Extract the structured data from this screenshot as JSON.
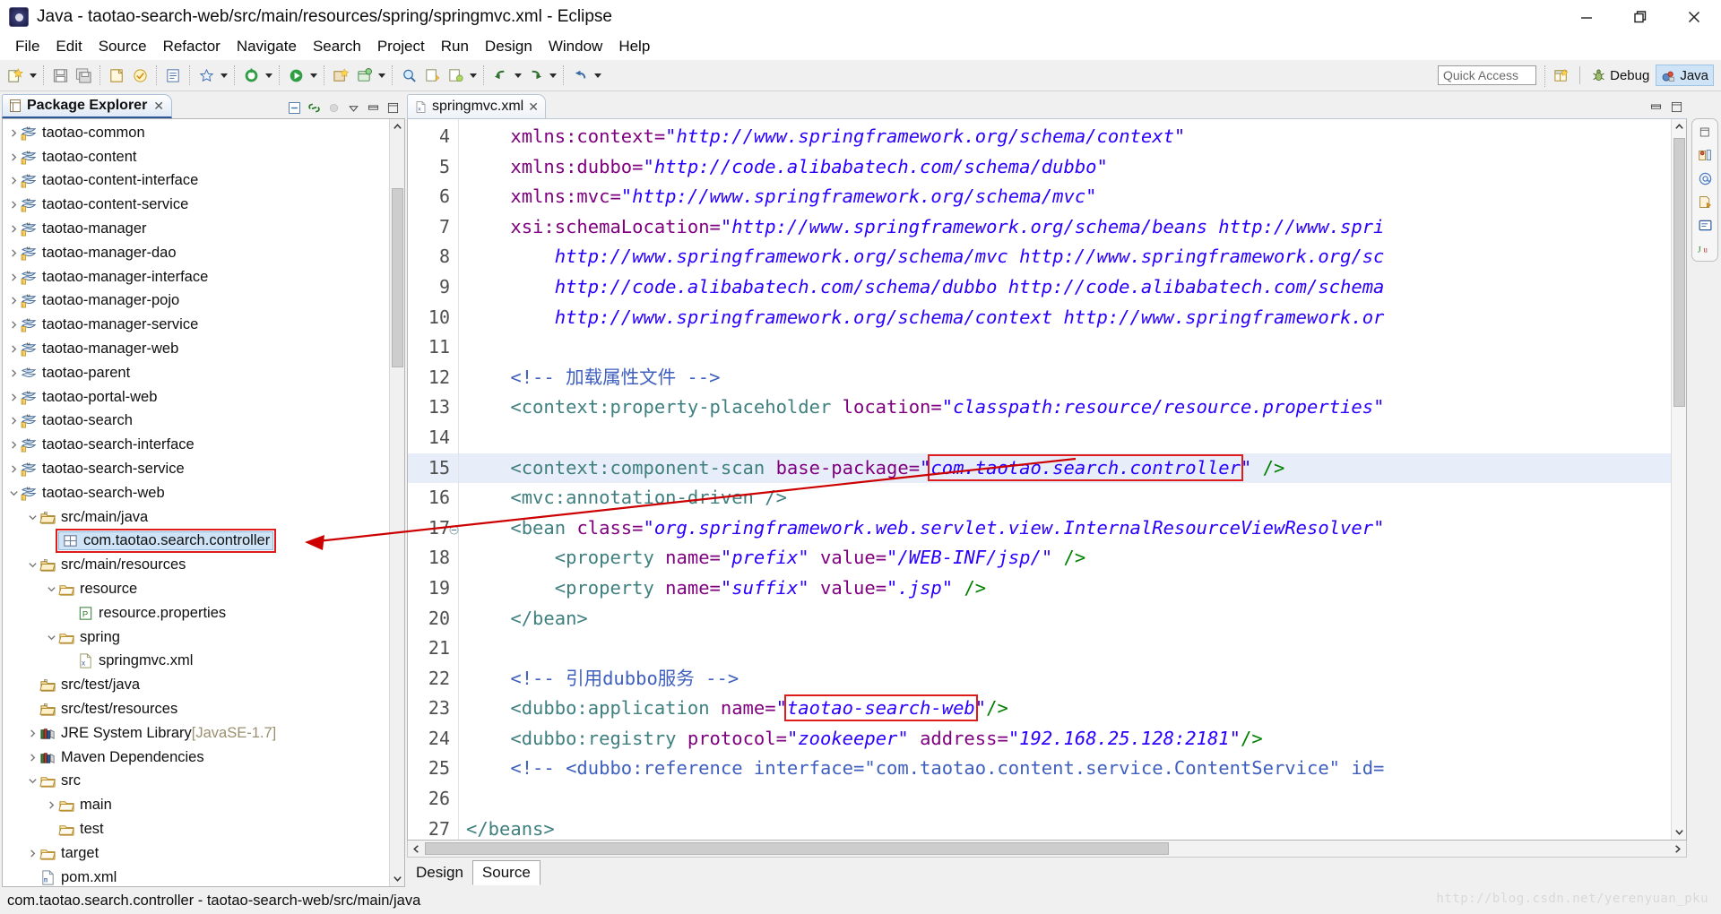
{
  "window": {
    "title": "Java - taotao-search-web/src/main/resources/spring/springmvc.xml - Eclipse",
    "app_icon": "eclipse-icon",
    "minimize_label": "Minimize",
    "restore_label": "Restore",
    "close_label": "Close"
  },
  "menubar": {
    "items": [
      "File",
      "Edit",
      "Source",
      "Refactor",
      "Navigate",
      "Search",
      "Project",
      "Run",
      "Design",
      "Window",
      "Help"
    ]
  },
  "toolbar": {
    "quick_access_placeholder": "Quick Access",
    "open_perspective_label": "Open Perspective",
    "perspectives": [
      {
        "label": "Debug",
        "icon": "debug-bug-icon",
        "active": false
      },
      {
        "label": "Java",
        "icon": "java-perspective-icon",
        "active": true
      }
    ],
    "buttons": [
      "new-wizard-icon",
      "new-wizard-dropdown",
      "save-icon",
      "save-all-icon",
      "print-icon",
      "build-icon",
      "new-java-class-icon",
      "external-tools-icon",
      "external-tools-dropdown",
      "debug-icon",
      "debug-dropdown",
      "run-icon",
      "run-dropdown",
      "new-java-project-icon",
      "new-package-icon",
      "new-package-dropdown",
      "search-icon",
      "next-annotation-icon",
      "previous-annotation-icon",
      "annotation-dropdown",
      "back-icon",
      "back-dropdown",
      "forward-icon",
      "undo-icon",
      "redo-icon",
      "pin-icon",
      "pin-dropdown"
    ]
  },
  "package_explorer": {
    "title": "Package Explorer",
    "close_label": "✕",
    "tools": [
      "collapse-all-icon",
      "link-with-editor-icon",
      "focus-on-active-task-icon",
      "view-menu-icon",
      "minimize-icon",
      "maximize-icon"
    ],
    "tree": [
      {
        "label": "taotao-common",
        "indent": 0,
        "twisty": "collapsed",
        "icon": "maven-project-icon"
      },
      {
        "label": "taotao-content",
        "indent": 0,
        "twisty": "collapsed",
        "icon": "maven-project-icon"
      },
      {
        "label": "taotao-content-interface",
        "indent": 0,
        "twisty": "collapsed",
        "icon": "maven-project-icon"
      },
      {
        "label": "taotao-content-service",
        "indent": 0,
        "twisty": "collapsed",
        "icon": "maven-project-icon"
      },
      {
        "label": "taotao-manager",
        "indent": 0,
        "twisty": "collapsed",
        "icon": "maven-project-icon"
      },
      {
        "label": "taotao-manager-dao",
        "indent": 0,
        "twisty": "collapsed",
        "icon": "maven-project-icon"
      },
      {
        "label": "taotao-manager-interface",
        "indent": 0,
        "twisty": "collapsed",
        "icon": "maven-project-icon"
      },
      {
        "label": "taotao-manager-pojo",
        "indent": 0,
        "twisty": "collapsed",
        "icon": "maven-project-icon"
      },
      {
        "label": "taotao-manager-service",
        "indent": 0,
        "twisty": "collapsed",
        "icon": "maven-project-icon"
      },
      {
        "label": "taotao-manager-web",
        "indent": 0,
        "twisty": "collapsed",
        "icon": "maven-project-icon"
      },
      {
        "label": "taotao-parent",
        "indent": 0,
        "twisty": "collapsed",
        "icon": "maven-pom-project-icon"
      },
      {
        "label": "taotao-portal-web",
        "indent": 0,
        "twisty": "collapsed",
        "icon": "maven-project-icon"
      },
      {
        "label": "taotao-search",
        "indent": 0,
        "twisty": "collapsed",
        "icon": "maven-project-icon"
      },
      {
        "label": "taotao-search-interface",
        "indent": 0,
        "twisty": "collapsed",
        "icon": "maven-project-icon"
      },
      {
        "label": "taotao-search-service",
        "indent": 0,
        "twisty": "collapsed",
        "icon": "maven-project-icon"
      },
      {
        "label": "taotao-search-web",
        "indent": 0,
        "twisty": "expanded",
        "icon": "maven-project-icon"
      },
      {
        "label": "src/main/java",
        "indent": 1,
        "twisty": "expanded",
        "icon": "source-folder-icon"
      },
      {
        "label": "com.taotao.search.controller",
        "indent": 2,
        "twisty": "none",
        "icon": "package-icon",
        "selected": true,
        "highlight": true
      },
      {
        "label": "src/main/resources",
        "indent": 1,
        "twisty": "expanded",
        "icon": "source-folder-icon"
      },
      {
        "label": "resource",
        "indent": 2,
        "twisty": "expanded",
        "icon": "folder-icon"
      },
      {
        "label": "resource.properties",
        "indent": 3,
        "twisty": "none",
        "icon": "properties-file-icon"
      },
      {
        "label": "spring",
        "indent": 2,
        "twisty": "expanded",
        "icon": "folder-icon"
      },
      {
        "label": "springmvc.xml",
        "indent": 3,
        "twisty": "none",
        "icon": "xml-file-icon"
      },
      {
        "label": "src/test/java",
        "indent": 1,
        "twisty": "none",
        "icon": "source-folder-icon"
      },
      {
        "label": "src/test/resources",
        "indent": 1,
        "twisty": "none",
        "icon": "source-folder-icon"
      },
      {
        "label": "JRE System Library",
        "suffix": " [JavaSE-1.7]",
        "indent": 1,
        "twisty": "collapsed",
        "icon": "library-icon"
      },
      {
        "label": "Maven Dependencies",
        "indent": 1,
        "twisty": "collapsed",
        "icon": "library-icon"
      },
      {
        "label": "src",
        "indent": 1,
        "twisty": "expanded",
        "icon": "folder-icon"
      },
      {
        "label": "main",
        "indent": 2,
        "twisty": "collapsed",
        "icon": "folder-icon"
      },
      {
        "label": "test",
        "indent": 2,
        "twisty": "none",
        "icon": "folder-icon"
      },
      {
        "label": "target",
        "indent": 1,
        "twisty": "collapsed",
        "icon": "folder-icon"
      },
      {
        "label": "pom.xml",
        "indent": 1,
        "twisty": "none",
        "icon": "maven-pom-icon"
      }
    ]
  },
  "editor": {
    "tab": {
      "title": "springmvc.xml",
      "close_label": "✕",
      "icon": "xml-file-icon"
    },
    "bottom_tabs": [
      {
        "label": "Design",
        "active": false
      },
      {
        "label": "Source",
        "active": true
      }
    ],
    "first_visible_line": 4,
    "current_line": 15,
    "lines": [
      {
        "n": 4,
        "segments": [
          {
            "t": "    ",
            "c": "pun"
          },
          {
            "t": "xmlns:context=",
            "c": "attr"
          },
          {
            "t": "\"http://www.springframework.org/schema/context\"",
            "c": "val"
          }
        ]
      },
      {
        "n": 5,
        "segments": [
          {
            "t": "    ",
            "c": "pun"
          },
          {
            "t": "xmlns:dubbo=",
            "c": "attr"
          },
          {
            "t": "\"http://code.alibabatech.com/schema/dubbo\"",
            "c": "val"
          }
        ]
      },
      {
        "n": 6,
        "segments": [
          {
            "t": "    ",
            "c": "pun"
          },
          {
            "t": "xmlns:mvc=",
            "c": "attr"
          },
          {
            "t": "\"http://www.springframework.org/schema/mvc\"",
            "c": "val"
          }
        ]
      },
      {
        "n": 7,
        "segments": [
          {
            "t": "    ",
            "c": "pun"
          },
          {
            "t": "xsi:schemaLocation=",
            "c": "attr"
          },
          {
            "t": "\"http://www.springframework.org/schema/beans http://www.spri",
            "c": "val"
          }
        ]
      },
      {
        "n": 8,
        "segments": [
          {
            "t": "        http://www.springframework.org/schema/mvc http://www.springframework.org/sc",
            "c": "val"
          }
        ]
      },
      {
        "n": 9,
        "segments": [
          {
            "t": "        http://code.alibabatech.com/schema/dubbo http://code.alibabatech.com/schema",
            "c": "val"
          }
        ]
      },
      {
        "n": 10,
        "segments": [
          {
            "t": "        http://www.springframework.org/schema/context http://www.springframework.or",
            "c": "val"
          }
        ]
      },
      {
        "n": 11,
        "segments": [
          {
            "t": "",
            "c": "pun"
          }
        ]
      },
      {
        "n": 12,
        "segments": [
          {
            "t": "    <!-- 加载属性文件 -->",
            "c": "cmt"
          }
        ]
      },
      {
        "n": 13,
        "segments": [
          {
            "t": "    ",
            "c": "pun"
          },
          {
            "t": "<context:property-placeholder ",
            "c": "tag"
          },
          {
            "t": "location=",
            "c": "attr"
          },
          {
            "t": "\"classpath:resource/resource.properties\"",
            "c": "val"
          }
        ]
      },
      {
        "n": 14,
        "segments": [
          {
            "t": "",
            "c": "pun"
          }
        ]
      },
      {
        "n": 15,
        "segments": [
          {
            "t": "    ",
            "c": "pun"
          },
          {
            "t": "<context:component-scan ",
            "c": "tag"
          },
          {
            "t": "base-package=",
            "c": "attr"
          },
          {
            "t": "\"",
            "c": "val"
          },
          {
            "t": "com.taotao.search.controller",
            "c": "val",
            "boxed": true
          },
          {
            "t": "\"",
            "c": "val"
          },
          {
            "t": " />",
            "c": "grn"
          }
        ]
      },
      {
        "n": 16,
        "segments": [
          {
            "t": "    ",
            "c": "pun"
          },
          {
            "t": "<mvc:annotation-driven />",
            "c": "tag"
          }
        ]
      },
      {
        "n": 17,
        "segments": [
          {
            "t": "    ",
            "c": "pun"
          },
          {
            "t": "<bean ",
            "c": "tag"
          },
          {
            "t": "class=",
            "c": "attr"
          },
          {
            "t": "\"org.springframework.web.servlet.view.InternalResourceViewResolver\"",
            "c": "val"
          }
        ]
      },
      {
        "n": 18,
        "segments": [
          {
            "t": "        ",
            "c": "pun"
          },
          {
            "t": "<property ",
            "c": "tag"
          },
          {
            "t": "name=",
            "c": "attr"
          },
          {
            "t": "\"prefix\"",
            "c": "val"
          },
          {
            "t": " ",
            "c": "pun"
          },
          {
            "t": "value=",
            "c": "attr"
          },
          {
            "t": "\"/WEB-INF/jsp/\"",
            "c": "val"
          },
          {
            "t": " />",
            "c": "grn"
          }
        ]
      },
      {
        "n": 19,
        "segments": [
          {
            "t": "        ",
            "c": "pun"
          },
          {
            "t": "<property ",
            "c": "tag"
          },
          {
            "t": "name=",
            "c": "attr"
          },
          {
            "t": "\"suffix\"",
            "c": "val"
          },
          {
            "t": " ",
            "c": "pun"
          },
          {
            "t": "value=",
            "c": "attr"
          },
          {
            "t": "\".jsp\"",
            "c": "val"
          },
          {
            "t": " />",
            "c": "grn"
          }
        ]
      },
      {
        "n": 20,
        "segments": [
          {
            "t": "    ",
            "c": "pun"
          },
          {
            "t": "</bean>",
            "c": "tag"
          }
        ]
      },
      {
        "n": 21,
        "segments": [
          {
            "t": "",
            "c": "pun"
          }
        ]
      },
      {
        "n": 22,
        "segments": [
          {
            "t": "    <!-- 引用dubbo服务 -->",
            "c": "cmt"
          }
        ]
      },
      {
        "n": 23,
        "segments": [
          {
            "t": "    ",
            "c": "pun"
          },
          {
            "t": "<dubbo:application ",
            "c": "tag"
          },
          {
            "t": "name=",
            "c": "attr"
          },
          {
            "t": "\"",
            "c": "val"
          },
          {
            "t": "taotao-search-web",
            "c": "val",
            "boxed": true
          },
          {
            "t": "\"",
            "c": "val"
          },
          {
            "t": "/>",
            "c": "grn"
          }
        ]
      },
      {
        "n": 24,
        "segments": [
          {
            "t": "    ",
            "c": "pun"
          },
          {
            "t": "<dubbo:registry ",
            "c": "tag"
          },
          {
            "t": "protocol=",
            "c": "attr"
          },
          {
            "t": "\"zookeeper\"",
            "c": "val"
          },
          {
            "t": " ",
            "c": "pun"
          },
          {
            "t": "address=",
            "c": "attr"
          },
          {
            "t": "\"192.168.25.128:2181\"",
            "c": "val"
          },
          {
            "t": "/>",
            "c": "grn"
          }
        ]
      },
      {
        "n": 25,
        "segments": [
          {
            "t": "    <!-- <dubbo:reference interface=\"com.taotao.content.service.ContentService\" id=",
            "c": "cmt"
          }
        ]
      },
      {
        "n": 26,
        "segments": [
          {
            "t": "",
            "c": "pun"
          }
        ]
      },
      {
        "n": 27,
        "segments": [
          {
            "t": "</beans>",
            "c": "tag"
          }
        ]
      }
    ]
  },
  "fastbar": {
    "icons": [
      "restore-view-icon",
      "java-browsing-icon",
      "at-sign-icon",
      "servers-icon",
      "console-icon",
      "junit-icon"
    ]
  },
  "statusbar": {
    "selection_text": "com.taotao.search.controller - taotao-search-web/src/main/java",
    "watermark": "http://blog.csdn.net/yerenyuan_pku"
  },
  "annotations": {
    "arrow_color": "#cc0000",
    "box_color": "#e01b1b"
  }
}
